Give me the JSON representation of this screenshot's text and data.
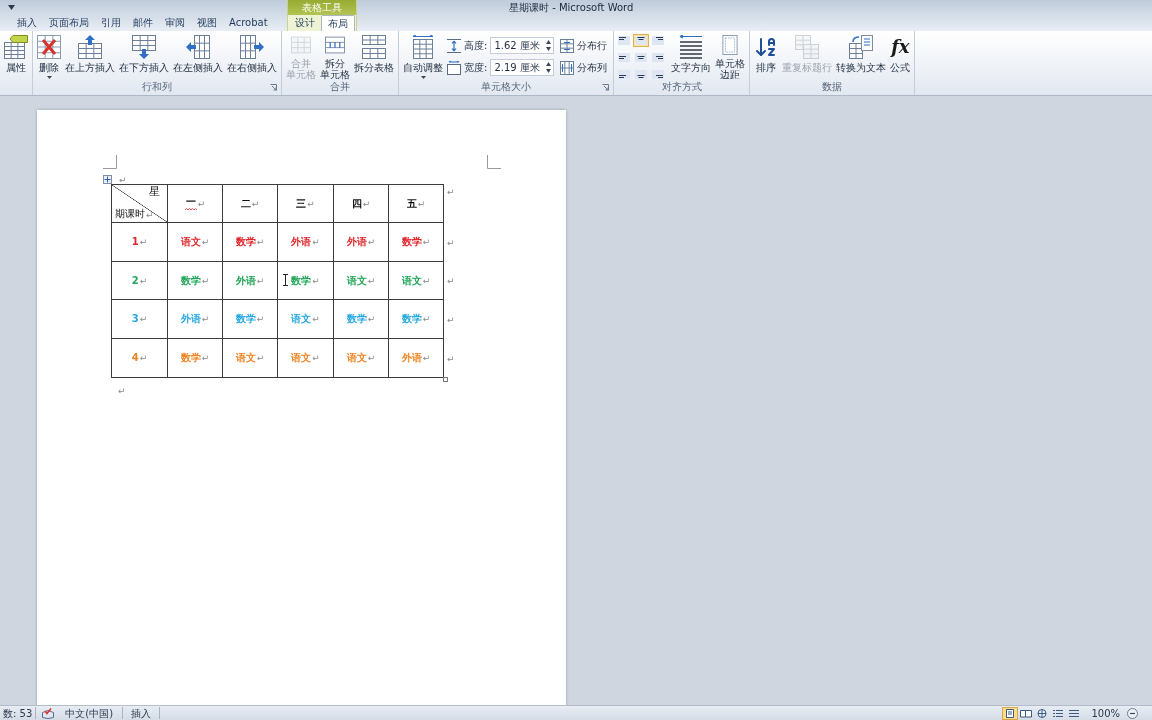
{
  "window": {
    "title": "星期课时 - Microsoft Word",
    "context_label": "表格工具"
  },
  "tabs": [
    {
      "label": "插入",
      "selected": false
    },
    {
      "label": "页面布局",
      "selected": false
    },
    {
      "label": "引用",
      "selected": false
    },
    {
      "label": "邮件",
      "selected": false
    },
    {
      "label": "审阅",
      "selected": false
    },
    {
      "label": "视图",
      "selected": false
    },
    {
      "label": "Acrobat",
      "selected": false
    }
  ],
  "context_tabs": [
    {
      "label": "设计",
      "selected": false
    },
    {
      "label": "布局",
      "selected": true
    }
  ],
  "ribbon": {
    "groups": [
      {
        "launcher": false,
        "items": [
          {
            "kind": "large",
            "label_lines": [
              "属性"
            ],
            "disabled": false,
            "dropdown": false
          }
        ]
      },
      {
        "label": "行和列",
        "launcher": true,
        "items": [
          {
            "kind": "large",
            "label_lines": [
              "删除"
            ],
            "disabled": false,
            "dropdown": true
          },
          {
            "kind": "large",
            "label_lines": [
              "在上方插入"
            ],
            "disabled": false,
            "dropdown": false
          },
          {
            "kind": "large",
            "label_lines": [
              "在下方插入"
            ],
            "disabled": false,
            "dropdown": false
          },
          {
            "kind": "large",
            "label_lines": [
              "在左侧插入"
            ],
            "disabled": false,
            "dropdown": false
          },
          {
            "kind": "large",
            "label_lines": [
              "在右侧插入"
            ],
            "disabled": false,
            "dropdown": false
          }
        ]
      },
      {
        "label": "合并",
        "launcher": false,
        "items": [
          {
            "kind": "large",
            "label_lines": [
              "合并",
              "单元格"
            ],
            "disabled": true,
            "dropdown": false
          },
          {
            "kind": "large",
            "label_lines": [
              "拆分",
              "单元格"
            ],
            "disabled": false,
            "dropdown": false
          },
          {
            "kind": "large",
            "label_lines": [
              "拆分表格"
            ],
            "disabled": false,
            "dropdown": false
          }
        ]
      },
      {
        "label": "单元格大小",
        "launcher": true,
        "items": [
          {
            "kind": "large",
            "label_lines": [
              "自动调整"
            ],
            "disabled": false,
            "dropdown": true
          },
          {
            "kind": "stack",
            "items": [
              {
                "kind": "spinner",
                "label": "高度:",
                "value": "1.62 厘米"
              },
              {
                "kind": "spinner",
                "label": "宽度:",
                "value": "2.19 厘米"
              }
            ]
          },
          {
            "kind": "stack",
            "items": [
              {
                "kind": "small",
                "label": "分布行",
                "disabled": false
              },
              {
                "kind": "small",
                "label": "分布列",
                "disabled": false
              }
            ]
          }
        ]
      },
      {
        "label": "对齐方式",
        "launcher": false,
        "items": [
          {
            "kind": "align_grid",
            "cells": [
              {
                "selected": false
              },
              {
                "selected": true
              },
              {
                "selected": false
              },
              {
                "selected": false
              },
              {
                "selected": false
              },
              {
                "selected": false
              },
              {
                "selected": false
              },
              {
                "selected": false
              },
              {
                "selected": false
              }
            ]
          },
          {
            "kind": "large",
            "label_lines": [
              "文字方向"
            ],
            "disabled": false,
            "dropdown": false
          },
          {
            "kind": "large",
            "label_lines": [
              "单元格",
              "边距"
            ],
            "disabled": false,
            "dropdown": false
          }
        ]
      },
      {
        "label": "数据",
        "launcher": false,
        "items": [
          {
            "kind": "large",
            "label_lines": [
              "排序"
            ],
            "disabled": false,
            "dropdown": false
          },
          {
            "kind": "large",
            "label_lines": [
              "重复标题行"
            ],
            "disabled": true,
            "dropdown": false
          },
          {
            "kind": "large",
            "label_lines": [
              "转换为文本"
            ],
            "disabled": false,
            "dropdown": false
          },
          {
            "kind": "large",
            "label_lines": [
              "公式"
            ],
            "glyph": "fx",
            "disabled": false,
            "dropdown": false
          }
        ]
      }
    ]
  },
  "document": {
    "top_mark": "↵",
    "table": {
      "corner": {
        "top": "星",
        "bottom": "期课时",
        "mark": "↵"
      },
      "header": [
        {
          "text": "一",
          "mark": "↵",
          "spelling_error": true
        },
        {
          "text": "二",
          "mark": "↵",
          "spelling_error": false
        },
        {
          "text": "三",
          "mark": "↵",
          "spelling_error": false
        },
        {
          "text": "四",
          "mark": "↵",
          "spelling_error": false
        },
        {
          "text": "五",
          "mark": "↵",
          "spelling_error": false
        }
      ],
      "header_end": "↵",
      "rows": [
        {
          "color": "#e0262a",
          "cells": [
            {
              "text": "1",
              "mark": "↵"
            },
            {
              "text": "语文",
              "mark": "↵"
            },
            {
              "text": "数学",
              "mark": "↵"
            },
            {
              "text": "外语",
              "mark": "↵"
            },
            {
              "text": "外语",
              "mark": "↵"
            },
            {
              "text": "数学",
              "mark": "↵"
            }
          ],
          "end": "↵"
        },
        {
          "color": "#21a558",
          "cells": [
            {
              "text": "2",
              "mark": "↵"
            },
            {
              "text": "数学",
              "mark": "↵"
            },
            {
              "text": "外语",
              "mark": "↵"
            },
            {
              "text": "数学",
              "mark": "↵"
            },
            {
              "text": "语文",
              "mark": "↵"
            },
            {
              "text": "语文",
              "mark": "↵"
            }
          ],
          "end": "↵"
        },
        {
          "color": "#27a8e0",
          "cells": [
            {
              "text": "3",
              "mark": "↵"
            },
            {
              "text": "外语",
              "mark": "↵"
            },
            {
              "text": "数学",
              "mark": "↵"
            },
            {
              "text": "语文",
              "mark": "↵"
            },
            {
              "text": "数学",
              "mark": "↵"
            },
            {
              "text": "数学",
              "mark": "↵"
            }
          ],
          "end": "↵"
        },
        {
          "color": "#f08424",
          "cells": [
            {
              "text": "4",
              "mark": "↵"
            },
            {
              "text": "数学",
              "mark": "↵"
            },
            {
              "text": "语文",
              "mark": "↵"
            },
            {
              "text": "语文",
              "mark": "↵"
            },
            {
              "text": "语文",
              "mark": "↵"
            },
            {
              "text": "外语",
              "mark": "↵"
            }
          ],
          "end": "↵"
        }
      ]
    },
    "bottom_mark": "↵"
  },
  "status_bar": {
    "word_count": "数: 53",
    "language": "中文(中国)",
    "mode": "插入",
    "views": [
      {
        "selected": true
      },
      {
        "selected": false
      },
      {
        "selected": false
      },
      {
        "selected": false
      },
      {
        "selected": false
      }
    ],
    "zoom": "100%"
  }
}
